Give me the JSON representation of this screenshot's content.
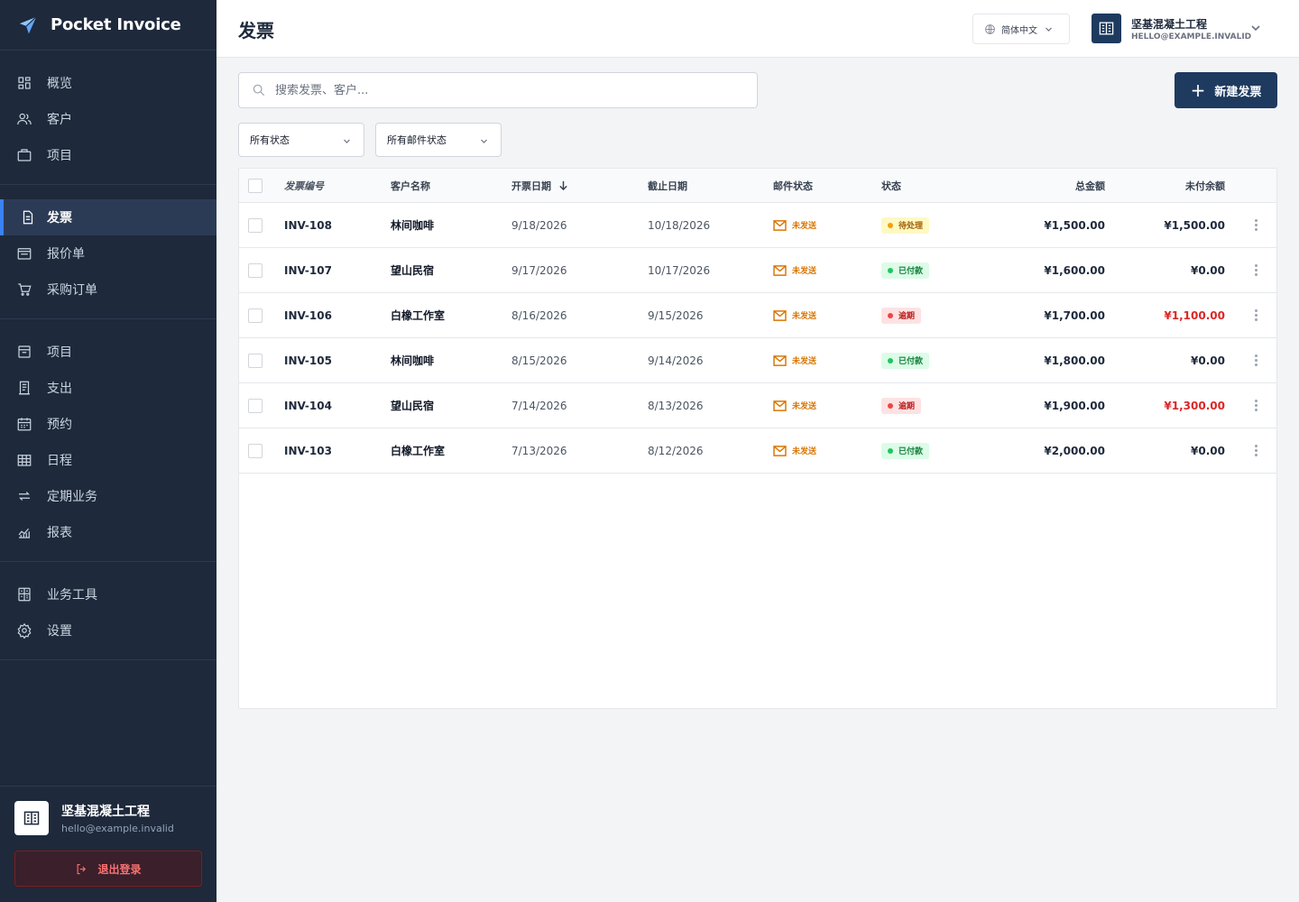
{
  "brand": {
    "name": "Pocket Invoice"
  },
  "nav": {
    "groups": [
      [
        {
          "label": "概览",
          "icon": "grid-icon",
          "active": false
        },
        {
          "label": "客户",
          "icon": "users-icon",
          "active": false
        },
        {
          "label": "项目",
          "icon": "briefcase-icon",
          "active": false
        }
      ],
      [
        {
          "label": "发票",
          "icon": "document-icon",
          "active": true
        },
        {
          "label": "报价单",
          "icon": "folder-icon",
          "active": false
        },
        {
          "label": "采购订单",
          "icon": "cart-icon",
          "active": false
        }
      ],
      [
        {
          "label": "项目",
          "icon": "archive-icon",
          "active": false
        },
        {
          "label": "支出",
          "icon": "receipt-icon",
          "active": false
        },
        {
          "label": "预约",
          "icon": "calendar-icon",
          "active": false
        },
        {
          "label": "日程",
          "icon": "table-icon",
          "active": false
        },
        {
          "label": "定期业务",
          "icon": "repeat-icon",
          "active": false
        },
        {
          "label": "报表",
          "icon": "chart-icon",
          "active": false
        }
      ],
      [
        {
          "label": "业务工具",
          "icon": "calculator-icon",
          "active": false
        },
        {
          "label": "设置",
          "icon": "gear-icon",
          "active": false
        }
      ]
    ]
  },
  "account": {
    "name": "坚基混凝土工程",
    "email": "hello@example.invalid",
    "logout_label": "退出登录"
  },
  "header": {
    "title": "发票",
    "language": "简体中文",
    "org_name": "坚基混凝土工程",
    "org_email": "HELLO@EXAMPLE.INVALID"
  },
  "toolbar": {
    "search_placeholder": "搜索发票、客户...",
    "new_button": "新建发票",
    "filter_status": "所有状态",
    "filter_mail": "所有邮件状态"
  },
  "table": {
    "columns": {
      "number": "发票编号",
      "customer": "客户名称",
      "issue_date": "开票日期",
      "due_date": "截止日期",
      "mail_status": "邮件状态",
      "status": "状态",
      "total": "总金额",
      "balance": "未付余额"
    },
    "rows": [
      {
        "number": "INV-108",
        "customer": "林间咖啡",
        "issue_date": "9/18/2026",
        "due_date": "10/18/2026",
        "mail": "未发送",
        "status": "待处理",
        "status_kind": "pending",
        "total": "¥1,500.00",
        "balance": "¥1,500.00",
        "balance_red": false
      },
      {
        "number": "INV-107",
        "customer": "望山民宿",
        "issue_date": "9/17/2026",
        "due_date": "10/17/2026",
        "mail": "未发送",
        "status": "已付款",
        "status_kind": "paid",
        "total": "¥1,600.00",
        "balance": "¥0.00",
        "balance_red": false
      },
      {
        "number": "INV-106",
        "customer": "白橡工作室",
        "issue_date": "8/16/2026",
        "due_date": "9/15/2026",
        "mail": "未发送",
        "status": "逾期",
        "status_kind": "overdue",
        "total": "¥1,700.00",
        "balance": "¥1,100.00",
        "balance_red": true
      },
      {
        "number": "INV-105",
        "customer": "林间咖啡",
        "issue_date": "8/15/2026",
        "due_date": "9/14/2026",
        "mail": "未发送",
        "status": "已付款",
        "status_kind": "paid",
        "total": "¥1,800.00",
        "balance": "¥0.00",
        "balance_red": false
      },
      {
        "number": "INV-104",
        "customer": "望山民宿",
        "issue_date": "7/14/2026",
        "due_date": "8/13/2026",
        "mail": "未发送",
        "status": "逾期",
        "status_kind": "overdue",
        "total": "¥1,900.00",
        "balance": "¥1,300.00",
        "balance_red": true
      },
      {
        "number": "INV-103",
        "customer": "白橡工作室",
        "issue_date": "7/13/2026",
        "due_date": "8/12/2026",
        "mail": "未发送",
        "status": "已付款",
        "status_kind": "paid",
        "total": "¥2,000.00",
        "balance": "¥0.00",
        "balance_red": false
      }
    ]
  },
  "colors": {
    "sidebar_bg": "#1e293b",
    "accent": "#1e3a5f",
    "active_bar": "#3b82f6",
    "pending_bg": "#fef9c3",
    "pending_fg": "#a16207",
    "pending_dot": "#f59e0b",
    "paid_bg": "#dcfce7",
    "paid_fg": "#15803d",
    "paid_dot": "#22c55e",
    "overdue_bg": "#fee2e2",
    "overdue_fg": "#b91c1c",
    "overdue_dot": "#ef4444"
  }
}
